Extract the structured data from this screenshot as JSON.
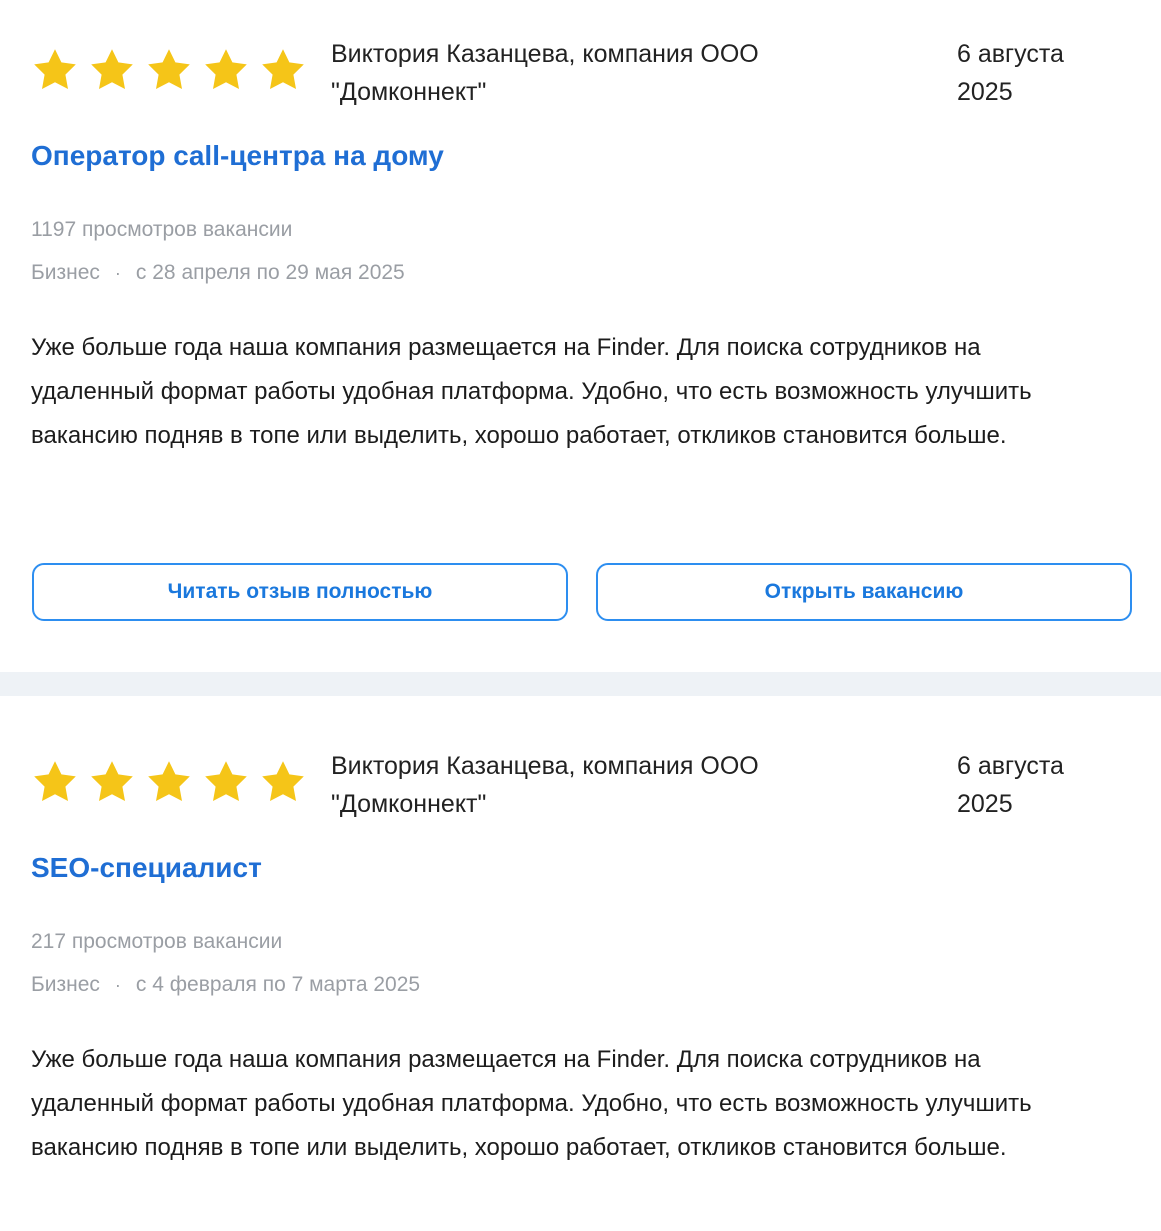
{
  "colors": {
    "star": "#f5c518",
    "title": "#1f6ed4",
    "button_border": "#2d8ef0",
    "button_text": "#1a78dd",
    "muted": "#9a9ea4",
    "separator": "#eef2f6"
  },
  "icons": {
    "star": "star-icon"
  },
  "reviews": [
    {
      "rating": 5,
      "author_line1": "Виктория Казанцева, компания ООО",
      "author_line2": "\"Домконнект\"",
      "date_line1": "6 августа",
      "date_line2": "2025",
      "title": "Оператор call-центра на дому",
      "views": "1197 просмотров вакансии",
      "category": "Бизнес",
      "period": "с 28 апреля по 29 мая 2025",
      "text": "Уже больше года наша компания размещается на Finder. Для поиска сотрудников на удаленный формат работы удобная платформа. Удобно, что есть возможность улучшить вакансию подняв в топе или выделить, хорошо работает, откликов становится больше.",
      "read_button": "Читать отзыв полностью",
      "open_button": "Открыть вакансию"
    },
    {
      "rating": 5,
      "author_line1": "Виктория Казанцева, компания ООО",
      "author_line2": "\"Домконнект\"",
      "date_line1": "6 августа",
      "date_line2": "2025",
      "title": "SEO-специалист",
      "views": "217 просмотров вакансии",
      "category": "Бизнес",
      "period": "с 4 февраля по 7 марта 2025",
      "text": "Уже больше года наша компания размещается на Finder. Для поиска сотрудников на удаленный формат работы удобная платформа. Удобно, что есть возможность улучшить вакансию подняв в топе или выделить, хорошо работает, откликов становится больше."
    }
  ]
}
